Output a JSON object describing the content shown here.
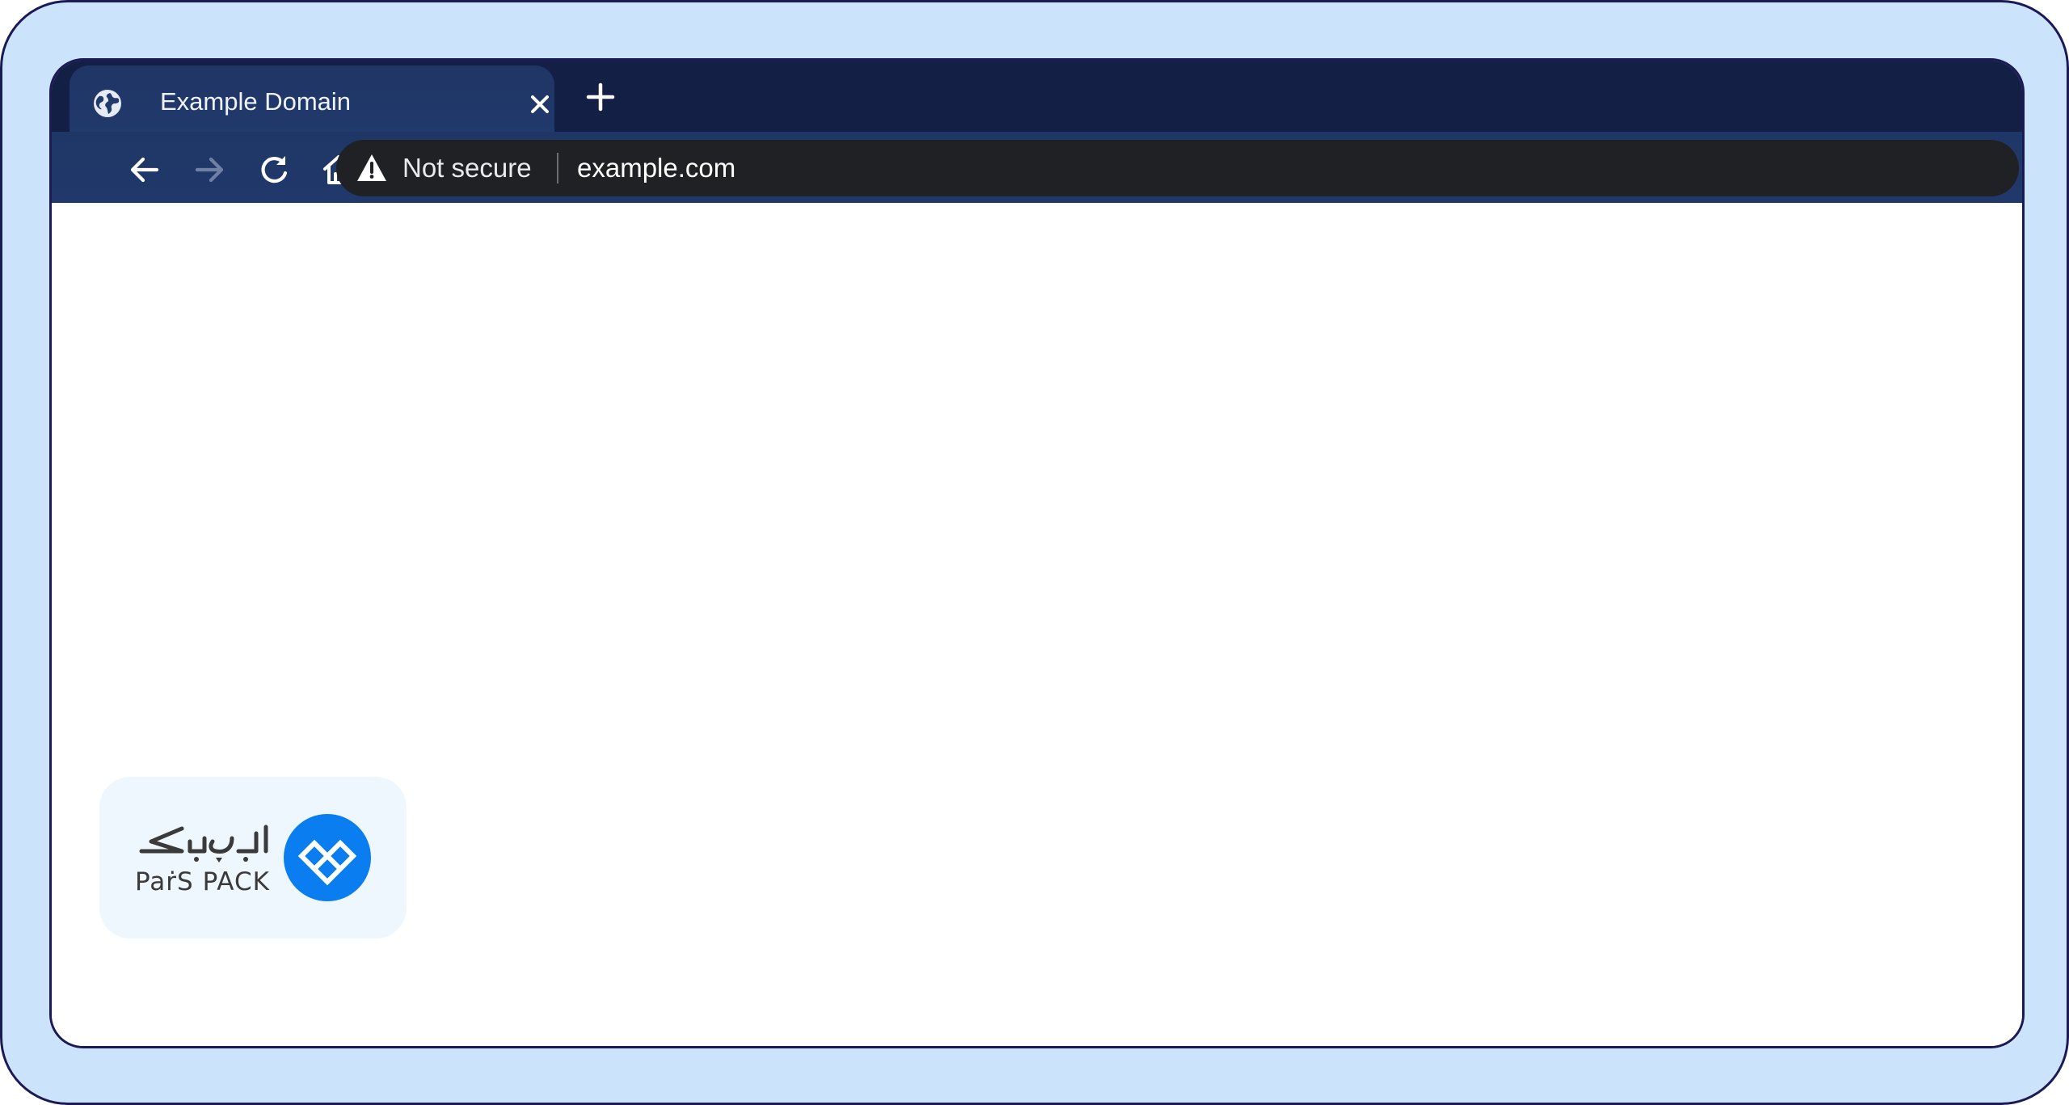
{
  "tab": {
    "title": "Example Domain",
    "favicon": "globe-icon",
    "close_icon": "close-icon"
  },
  "new_tab_icon": "plus-icon",
  "toolbar": {
    "back_icon": "arrow-left-icon",
    "forward_icon": "arrow-right-icon",
    "reload_icon": "reload-icon",
    "home_icon": "home-icon"
  },
  "omnibox": {
    "security_icon": "warning-triangle-icon",
    "security_label": "Not secure",
    "url": "example.com"
  },
  "brand": {
    "name_en": "PaṙS PACK",
    "name_fa": "پارس پک",
    "logo_icon": "parspack-logo-icon",
    "accent_color": "#0a7df0"
  },
  "colors": {
    "frame_background": "#cbe4fc",
    "frame_border": "#1c1a55",
    "chrome_dark": "#131f44",
    "toolbar": "#20396a",
    "omnibox": "#202124"
  }
}
